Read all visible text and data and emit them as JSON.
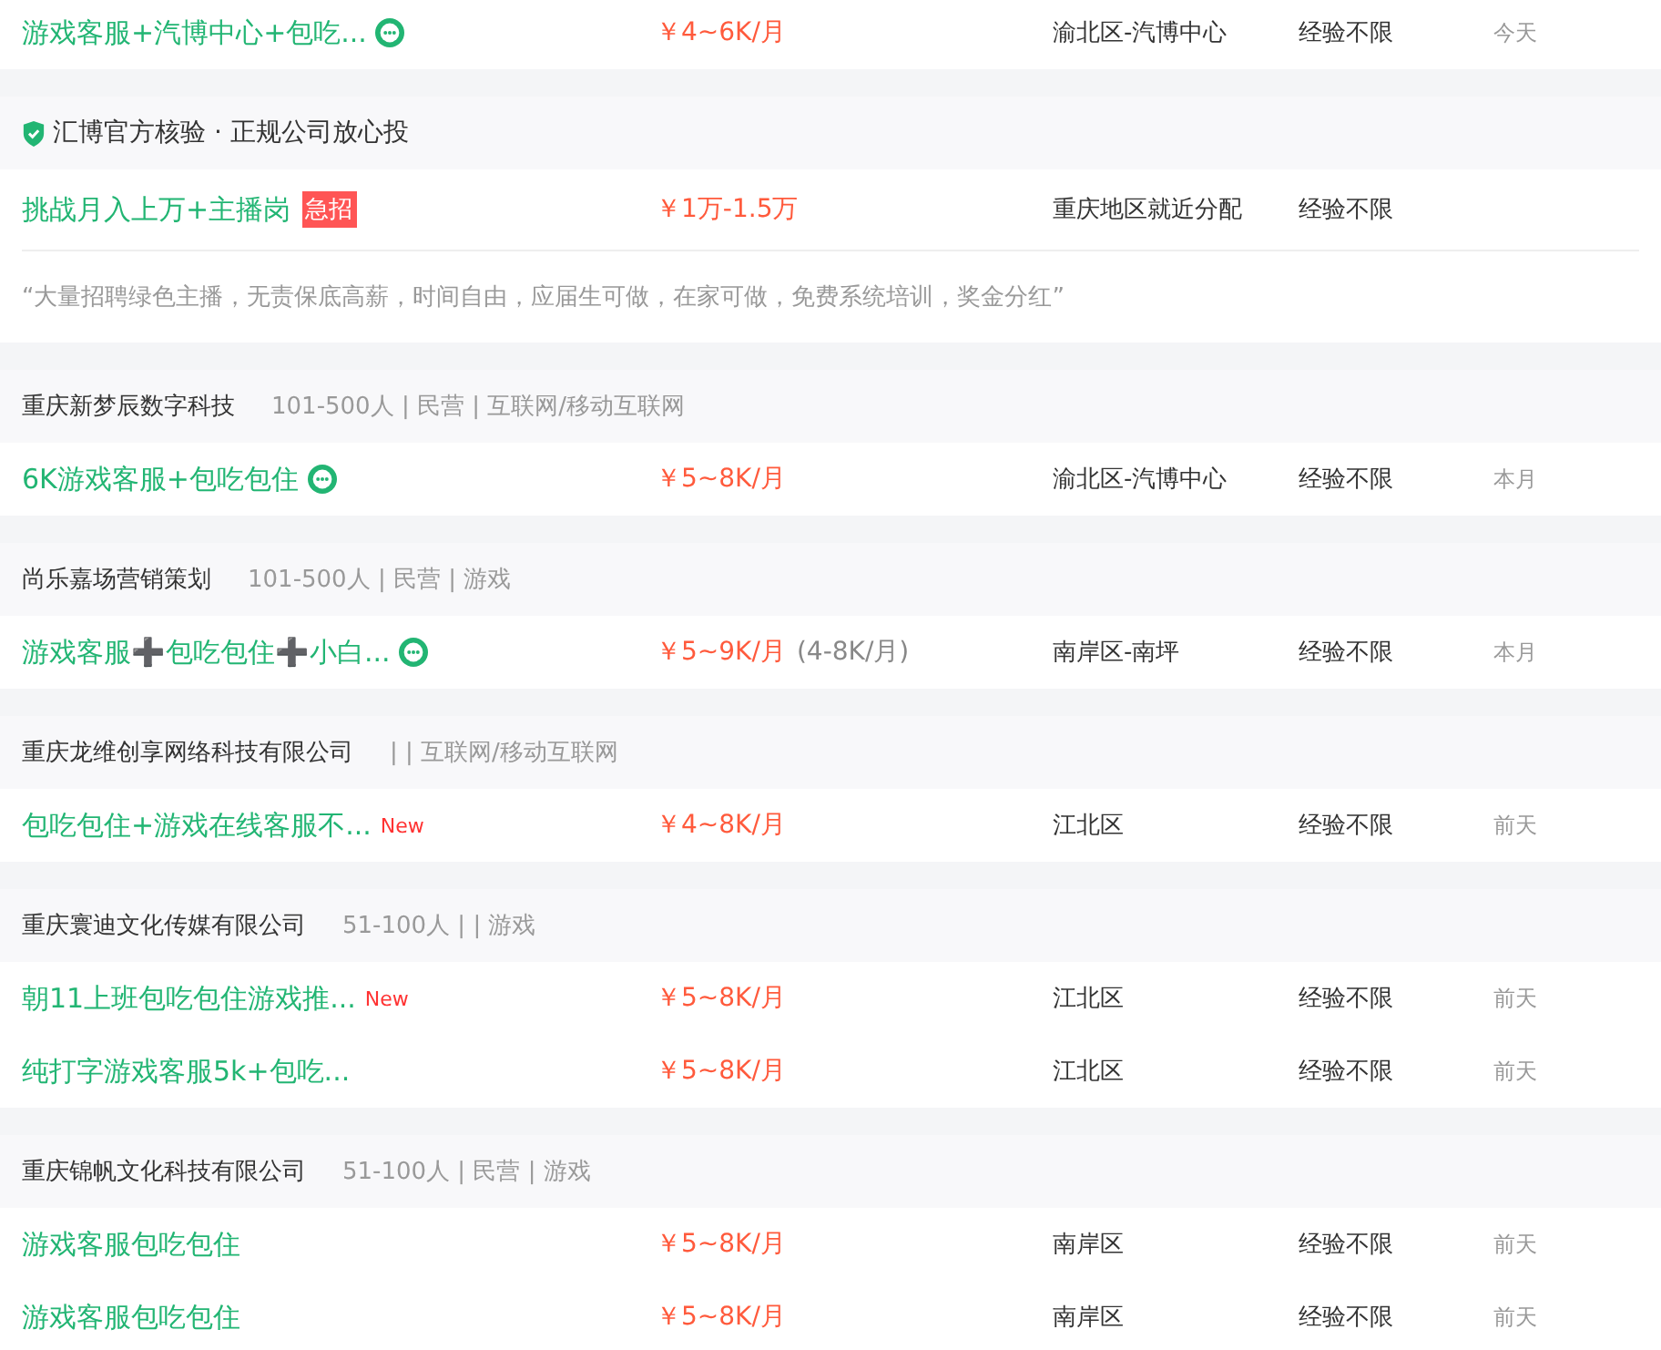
{
  "groups": [
    {
      "jobs": [
        {
          "title": "游戏客服+汽博中心+包吃...",
          "chat": true,
          "salary": "￥4~6K/月",
          "location": "渝北区-汽博中心",
          "experience": "经验不限",
          "date": "今天"
        }
      ]
    },
    {
      "header": {
        "kind": "verified",
        "text": "汇博官方核验 · 正规公司放心投"
      },
      "jobs": [
        {
          "title": "挑战月入上万+主播岗",
          "chat": false,
          "tag": {
            "kind": "urgent",
            "text": "急招"
          },
          "salary": "￥1万-1.5万",
          "location": "重庆地区就近分配",
          "experience": "经验不限"
        }
      ],
      "description": "“大量招聘绿色主播，无责保底高薪，时间自由，应届生可做，在家可做，免费系统培训，奖金分红”"
    },
    {
      "header": {
        "kind": "company",
        "name": "重庆新梦辰数字科技",
        "meta": "101-500人 | 民营 | 互联网/移动互联网"
      },
      "jobs": [
        {
          "title": "6K游戏客服+包吃包住",
          "chat": true,
          "salary": "￥5~8K/月",
          "location": "渝北区-汽博中心",
          "experience": "经验不限",
          "date": "本月"
        }
      ]
    },
    {
      "header": {
        "kind": "company",
        "name": "尚乐嘉场营销策划",
        "meta": "101-500人 | 民营 | 游戏"
      },
      "jobs": [
        {
          "title": "游戏客服➕包吃包住➕小白...",
          "chat": true,
          "salary": "￥5~9K/月",
          "salary_note": "(4-8K/月)",
          "location": "南岸区-南坪",
          "experience": "经验不限",
          "date": "本月"
        }
      ]
    },
    {
      "header": {
        "kind": "company",
        "name": "重庆龙维创享网络科技有限公司",
        "meta": "| | 互联网/移动互联网"
      },
      "jobs": [
        {
          "title": "包吃包住+游戏在线客服不...",
          "chat": false,
          "tag": {
            "kind": "new",
            "text": "New"
          },
          "salary": "￥4~8K/月",
          "location": "江北区",
          "experience": "经验不限",
          "date": "前天"
        }
      ]
    },
    {
      "header": {
        "kind": "company",
        "name": "重庆寰迪文化传媒有限公司",
        "meta": "51-100人 | | 游戏"
      },
      "jobs": [
        {
          "title": "朝11上班包吃包住游戏推...",
          "chat": false,
          "tag": {
            "kind": "new",
            "text": "New"
          },
          "salary": "￥5~8K/月",
          "location": "江北区",
          "experience": "经验不限",
          "date": "前天"
        },
        {
          "title": "纯打字游戏客服5k+包吃...",
          "chat": false,
          "salary": "￥5~8K/月",
          "location": "江北区",
          "experience": "经验不限",
          "date": "前天"
        }
      ]
    },
    {
      "header": {
        "kind": "company",
        "name": "重庆锦帆文化科技有限公司",
        "meta": "51-100人 | 民营 | 游戏"
      },
      "jobs": [
        {
          "title": "游戏客服包吃包住",
          "chat": false,
          "salary": "￥5~8K/月",
          "location": "南岸区",
          "experience": "经验不限",
          "date": "前天"
        },
        {
          "title": "游戏客服包吃包住",
          "chat": false,
          "salary": "￥5~8K/月",
          "location": "南岸区",
          "experience": "经验不限",
          "date": "前天"
        }
      ]
    }
  ]
}
